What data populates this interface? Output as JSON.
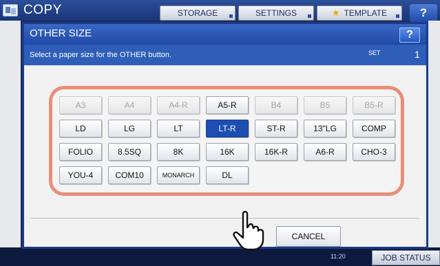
{
  "app": {
    "title": "COPY",
    "tabs": [
      {
        "label": "STORAGE"
      },
      {
        "label": "SETTINGS"
      },
      {
        "label": "TEMPLATE"
      }
    ],
    "help": "?",
    "bottom": {
      "time": "11:20",
      "job_status": "JOB STATUS"
    }
  },
  "dialog": {
    "title": "OTHER SIZE",
    "help": "?",
    "instruction": "Select a paper size for the OTHER button.",
    "set_label": "SET",
    "set_count": "1",
    "paper_sizes": [
      {
        "label": "A3",
        "state": "disabled"
      },
      {
        "label": "A4",
        "state": "disabled"
      },
      {
        "label": "A4-R",
        "state": "disabled"
      },
      {
        "label": "A5-R",
        "state": "enabled"
      },
      {
        "label": "B4",
        "state": "disabled"
      },
      {
        "label": "B5",
        "state": "disabled"
      },
      {
        "label": "B5-R",
        "state": "disabled"
      },
      {
        "label": "LD",
        "state": "enabled"
      },
      {
        "label": "LG",
        "state": "enabled"
      },
      {
        "label": "LT",
        "state": "enabled"
      },
      {
        "label": "LT-R",
        "state": "selected"
      },
      {
        "label": "ST-R",
        "state": "enabled"
      },
      {
        "label": "13\"LG",
        "state": "enabled"
      },
      {
        "label": "COMP",
        "state": "enabled"
      },
      {
        "label": "FOLIO",
        "state": "enabled"
      },
      {
        "label": "8.5SQ",
        "state": "enabled"
      },
      {
        "label": "8K",
        "state": "enabled"
      },
      {
        "label": "16K",
        "state": "enabled"
      },
      {
        "label": "16K-R",
        "state": "enabled"
      },
      {
        "label": "A6-R",
        "state": "enabled"
      },
      {
        "label": "CHO-3",
        "state": "enabled"
      },
      {
        "label": "YOU-4",
        "state": "enabled"
      },
      {
        "label": "COM10",
        "state": "enabled"
      },
      {
        "label": "MONARCH",
        "state": "enabled"
      },
      {
        "label": "DL",
        "state": "enabled"
      }
    ],
    "cancel_label": "CANCEL"
  },
  "colors": {
    "header_blue": "#1f4aa6",
    "selected_blue": "#1d4fb3",
    "highlight_frame": "#e88e78"
  }
}
